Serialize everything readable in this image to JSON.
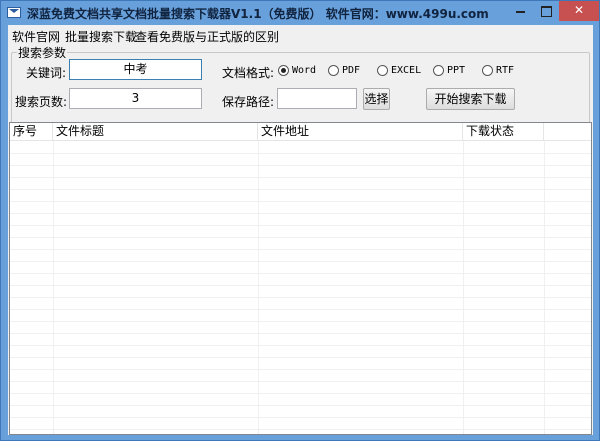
{
  "window": {
    "title": "深蓝免费文档共享文档批量搜索下载器V1.1（免费版） 软件官网：www.499u.com"
  },
  "menu": [
    {
      "label": "软件官网"
    },
    {
      "label": "批量搜索下载"
    },
    {
      "label": "查看免费版与正式版的区别"
    }
  ],
  "search_params": {
    "group_label": "搜索参数",
    "keyword_label": "关键词:",
    "keyword_value": "中考",
    "format_label": "文档格式:",
    "formats": [
      {
        "label": "Word",
        "checked": true
      },
      {
        "label": "PDF",
        "checked": false
      },
      {
        "label": "EXCEL",
        "checked": false
      },
      {
        "label": "PPT",
        "checked": false
      },
      {
        "label": "RTF",
        "checked": false
      }
    ],
    "pages_label": "搜索页数:",
    "pages_value": "3",
    "save_path_label": "保存路径:",
    "save_path_value": "",
    "choose_button": "选择",
    "start_button": "开始搜索下载"
  },
  "results_table": {
    "columns": [
      "序号",
      "文件标题",
      "文件地址",
      "下载状态",
      ""
    ],
    "rows": []
  }
}
